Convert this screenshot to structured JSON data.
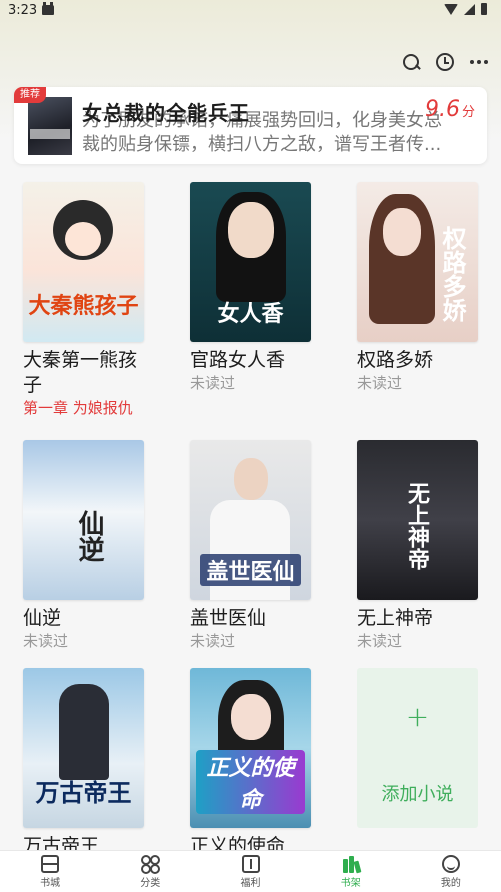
{
  "status_bar": {
    "time": "3:23"
  },
  "top_actions": {
    "icons": [
      "search-icon",
      "history-icon",
      "more-icon"
    ]
  },
  "recommend": {
    "badge": "推荐",
    "title": "女总裁的全能兵王",
    "score": "9.6",
    "score_unit": "分",
    "desc_line1": "为了朋友的承诺，痛展强势回归，化身美女总",
    "desc_line2": "裁的贴身保镖，横扫八方之敌，谱写王者传..."
  },
  "books": [
    {
      "name": "大秦第一熊孩子",
      "status": "第一章 为娘报仇",
      "cover_text": "大秦熊孩子"
    },
    {
      "name": "官路女人香",
      "status": "未读过",
      "cover_text": "女人香"
    },
    {
      "name": "权路多娇",
      "status": "未读过",
      "cover_text": "权路多娇"
    },
    {
      "name": "仙逆",
      "status": "未读过",
      "cover_text": "仙逆"
    },
    {
      "name": "盖世医仙",
      "status": "未读过",
      "cover_text": "盖世医仙"
    },
    {
      "name": "无上神帝",
      "status": "未读过",
      "cover_text": "无上神帝"
    },
    {
      "name": "万古帝王",
      "status": "",
      "cover_text": "万古帝王"
    },
    {
      "name": "正义的使命",
      "status": "",
      "cover_text": "正义的使命"
    }
  ],
  "add_card": {
    "plus": "+",
    "label": "添加小说"
  },
  "bottom_nav": [
    {
      "label": "书城"
    },
    {
      "label": "分类"
    },
    {
      "label": "福利"
    },
    {
      "label": "书架"
    },
    {
      "label": "我的"
    }
  ],
  "colors": {
    "accent_green": "#2fae4e",
    "accent_red": "#e23b3b"
  }
}
